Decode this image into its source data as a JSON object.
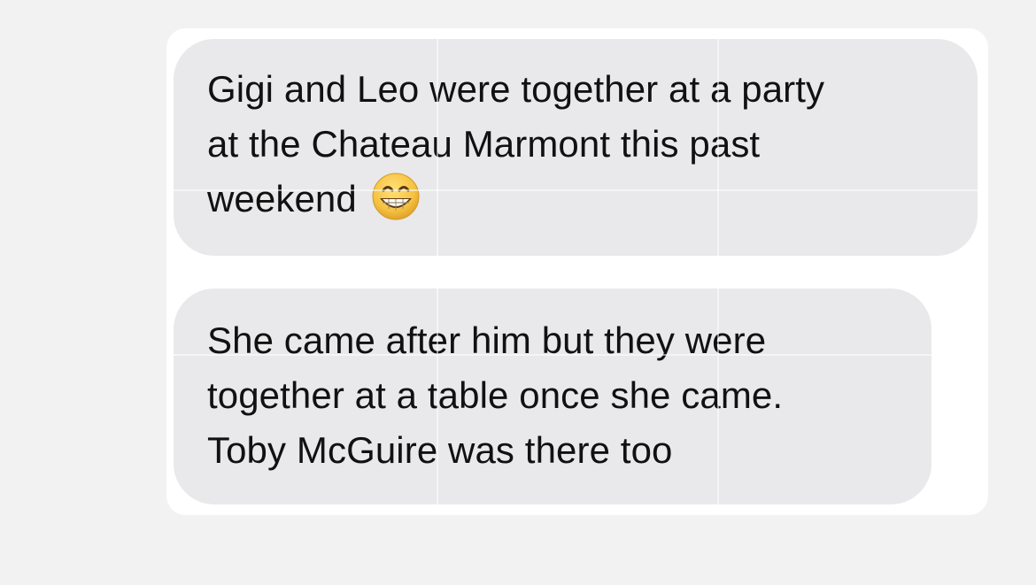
{
  "messages": [
    {
      "lines": [
        "Gigi and Leo were together at a party",
        "at the Chateau Marmont this past",
        "weekend"
      ],
      "emoji": "grinning-face-with-smiling-eyes-icon"
    },
    {
      "lines": [
        "She came after him but they were",
        "together at a table once she came.",
        "Toby McGuire was there too"
      ]
    }
  ],
  "colors": {
    "background": "#f2f2f2",
    "card": "#ffffff",
    "bubble": "#e9e9eb",
    "text": "#111111",
    "emoji_face": "#f5c242"
  }
}
